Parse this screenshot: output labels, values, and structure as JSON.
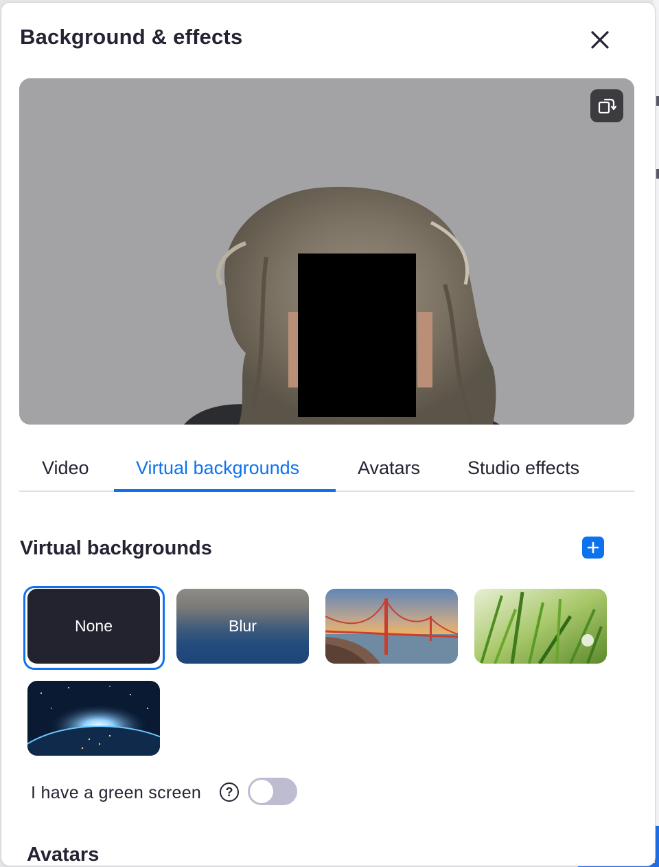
{
  "dialog": {
    "title": "Background & effects",
    "icons": {
      "close": "close-icon",
      "rotate": "rotate-camera-icon",
      "add": "plus-icon",
      "help": "question-icon"
    }
  },
  "tabs": [
    {
      "label": "Video",
      "active": false
    },
    {
      "label": "Virtual backgrounds",
      "active": true
    },
    {
      "label": "Avatars",
      "active": false
    },
    {
      "label": "Studio effects",
      "active": false
    }
  ],
  "virtual_backgrounds": {
    "title": "Virtual backgrounds",
    "tiles": [
      {
        "label": "None",
        "selected": true
      },
      {
        "label": "Blur",
        "selected": false
      },
      {
        "label": "",
        "image": "golden-gate-bridge",
        "selected": false
      },
      {
        "label": "",
        "image": "grass",
        "selected": false
      },
      {
        "label": "",
        "image": "earth-from-space",
        "selected": false
      }
    ]
  },
  "green_screen": {
    "label": "I have a green screen",
    "help_glyph": "?",
    "enabled": false
  },
  "avatars_section": {
    "title": "Avatars"
  },
  "colors": {
    "accent": "#0e72ed",
    "text": "#232333",
    "preview_bg": "#a3a3a6",
    "toggle_off": "#bdbcd1"
  }
}
